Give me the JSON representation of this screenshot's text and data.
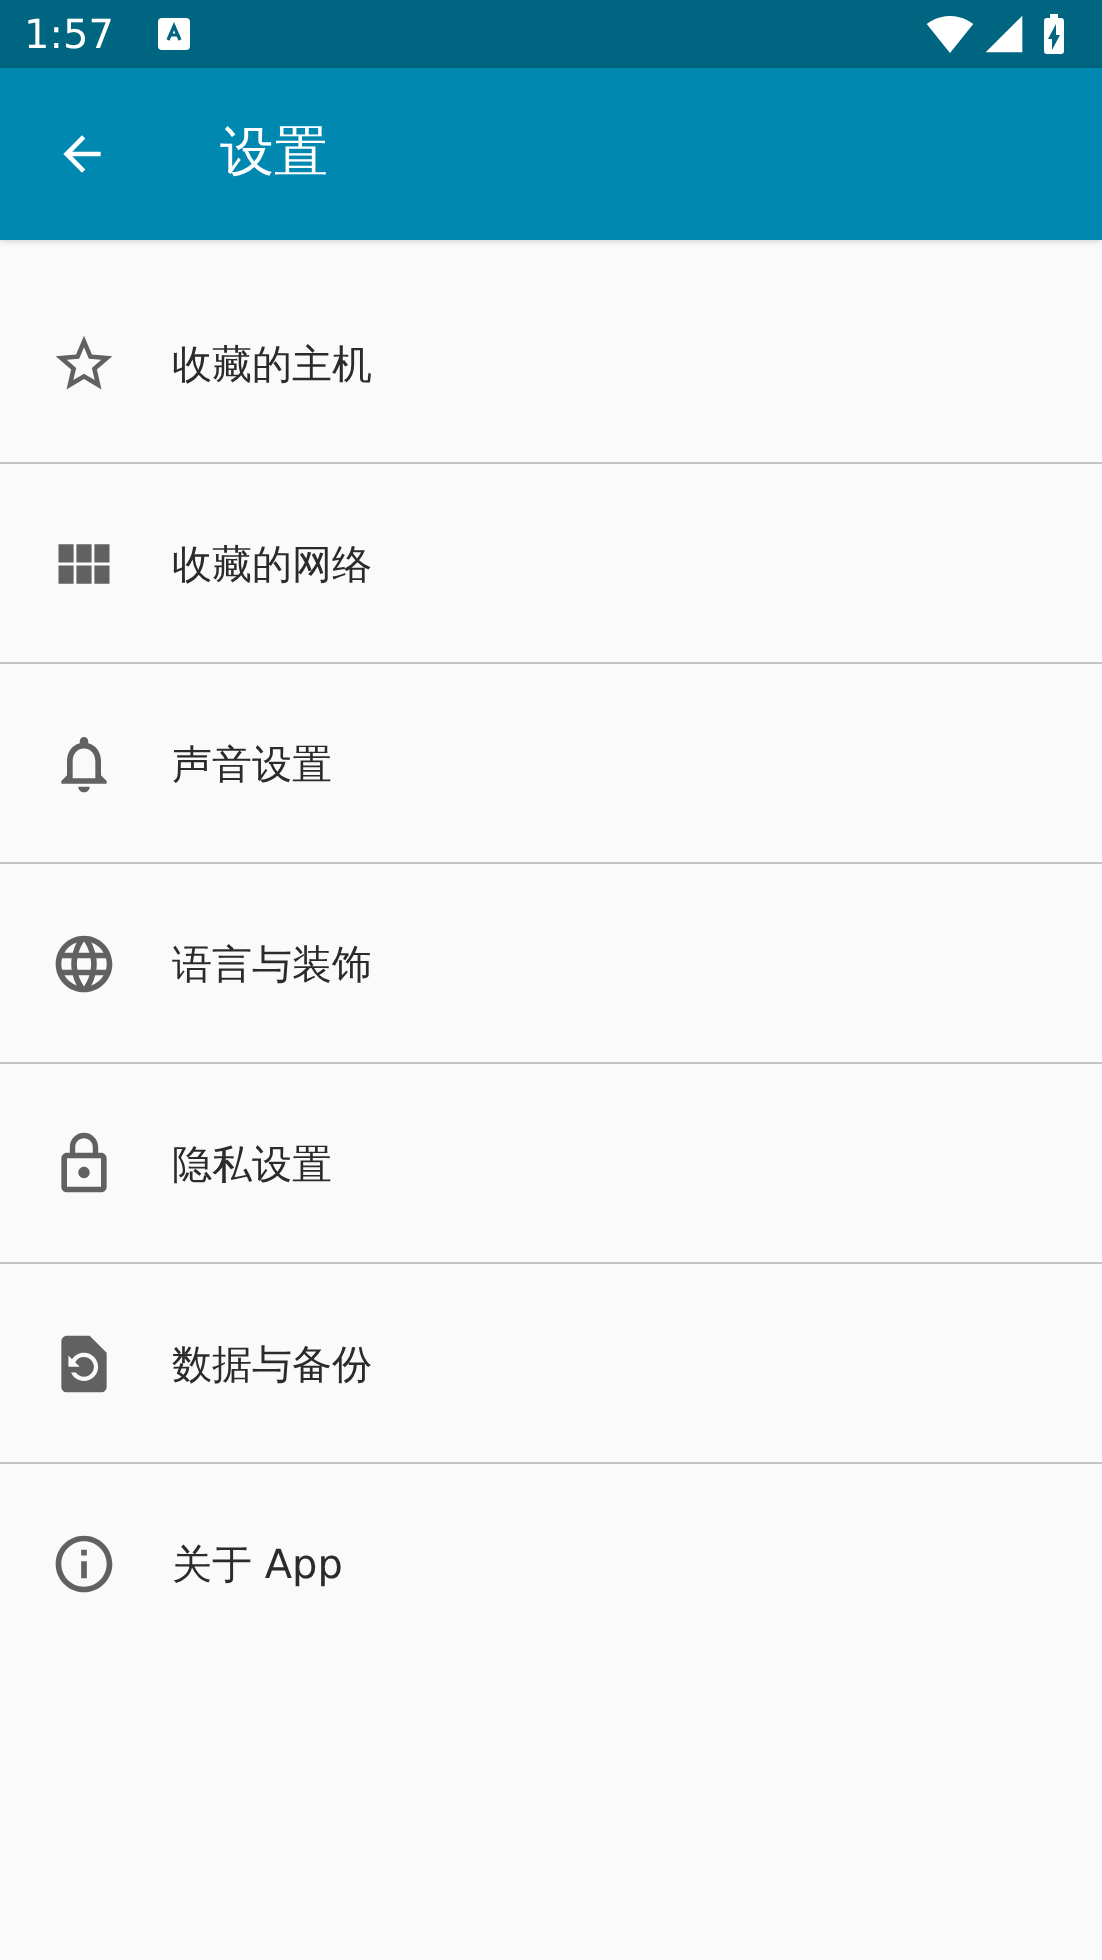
{
  "status_bar": {
    "time": "1:57"
  },
  "app_bar": {
    "title": "设置"
  },
  "items": [
    {
      "kind": "star",
      "label": "收藏的主机"
    },
    {
      "kind": "grid",
      "label": "收藏的网络"
    },
    {
      "kind": "bell",
      "label": "声音设置"
    },
    {
      "kind": "globe",
      "label": "语言与装饰"
    },
    {
      "kind": "lock",
      "label": "隐私设置"
    },
    {
      "kind": "restore",
      "label": "数据与备份"
    },
    {
      "kind": "info",
      "label": "关于 App"
    }
  ]
}
